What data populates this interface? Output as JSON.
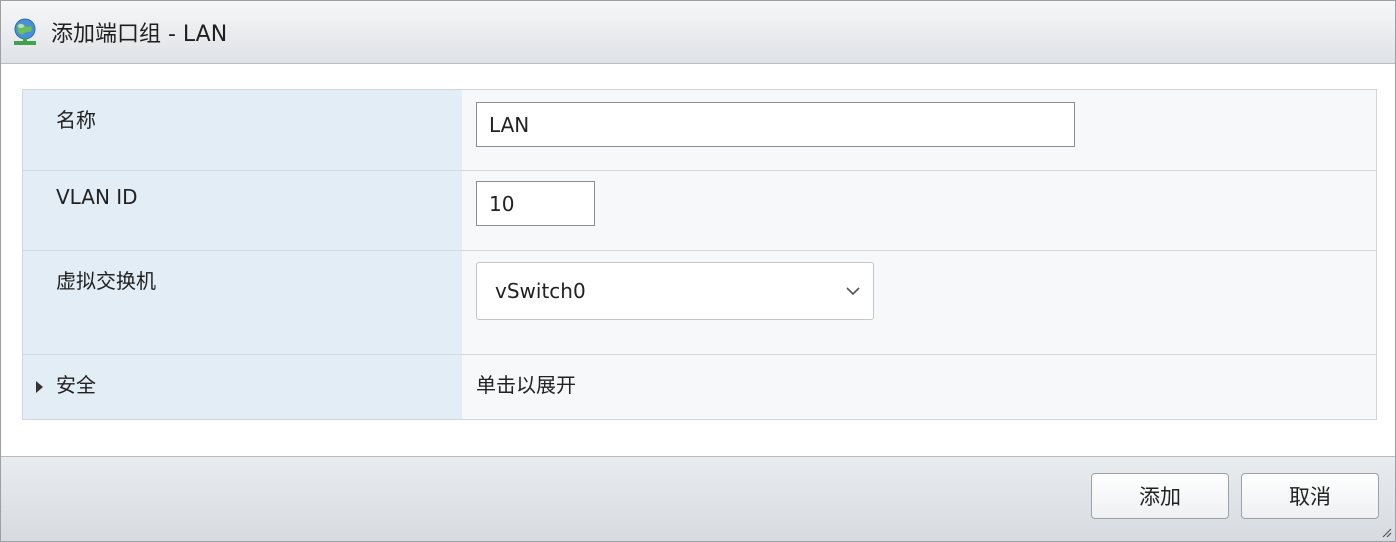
{
  "dialog": {
    "title": "添加端口组 - LAN",
    "icon": "network-portgroup-icon"
  },
  "form": {
    "name": {
      "label": "名称",
      "value": "LAN"
    },
    "vlan": {
      "label": "VLAN ID",
      "value": "10"
    },
    "vswitch": {
      "label": "虚拟交换机",
      "selected": "vSwitch0"
    },
    "security": {
      "label": "安全",
      "hint": "单击以展开"
    }
  },
  "footer": {
    "add_label": "添加",
    "cancel_label": "取消"
  },
  "colors": {
    "label_bg": "#e3edf6",
    "value_bg": "#f7f8f9",
    "title_bg": "#dfe2e6"
  }
}
